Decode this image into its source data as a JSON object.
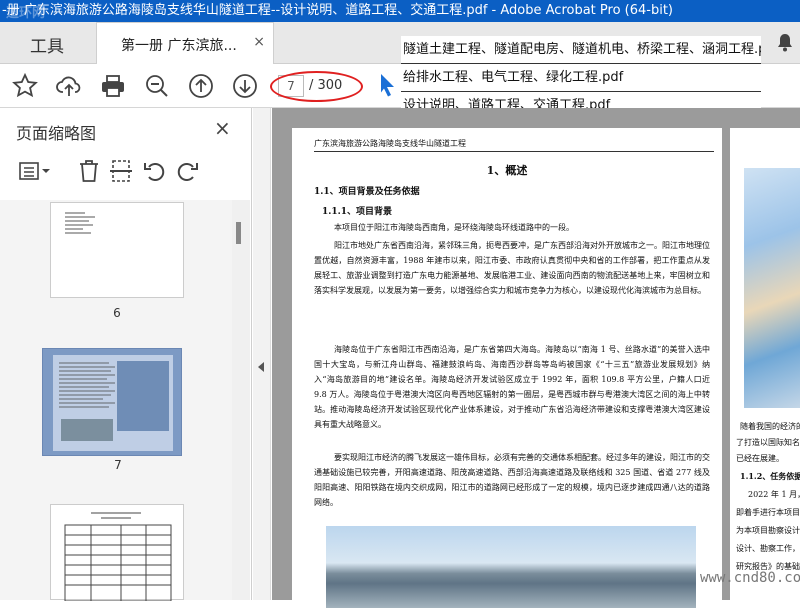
{
  "window": {
    "title": "-册 广东滨海旅游公路海陵岛支线华山隧道工程--设计说明、道路工程、交通工程.pdf - Adobe Acrobat Pro (64-bit)"
  },
  "tabs": {
    "tools_label": "工具",
    "doc_label": "第一册 广东滨旅...",
    "close": "×"
  },
  "toolbar": {
    "current_page": "7",
    "total_pages": "/ 300"
  },
  "file_list": [
    "隧道土建工程、隧道配电房、隧道机电、桥梁工程、涵洞工程.pdf",
    "给排水工程、电气工程、绿化工程.pdf",
    "设计说明、道路工程、交通工程.pdf"
  ],
  "thumbnails_panel": {
    "title": "页面缩略图",
    "close": "×",
    "pages": [
      {
        "label": "6"
      },
      {
        "label": "7"
      },
      {
        "label": ""
      }
    ]
  },
  "document": {
    "running_head": "广东滨海旅游公路海陵岛支线华山隧道工程",
    "section_title": "1、概述",
    "h1": "1.1、项目背景及任务依据",
    "h2": "1.1.1、项目背景",
    "paragraphs": [
      "本项目位于阳江市海陵岛西南角，是环绕海陵岛环线道路中的一段。",
      "阳江市地处广东省西南沿海，紧邻珠三角，扼粤西要冲，是广东西部沿海对外开放城市之一。阳江市地理位置优越，自然资源丰富，1988 年建市以来，阳江市委、市政府认真贯彻中央和省的工作部署，把工作重点从发展轻工、旅游业调整到打造广东电力能源基地、发展临港工业、建设面向西南的物流配送基地上来，牢固树立和落实科学发展观，以发展为第一要务，以增强综合实力和城市竞争力为核心，以建设现代化海滨城市为总目标。",
      "海陵岛位于广东省阳江市西南沿海，是广东省第四大海岛。海陵岛以“南海 1 号、丝路水道”的美誉入选中国十大宝岛，与新江舟山群岛、福建鼓浪屿岛、海南西沙群岛等岛屿被国家《“十三五”旅游业发展规划》纳入“海岛旅游目的地”建设名单。海陵岛经济开发试验区成立于 1992 年，面积 109.8 平方公里，户籍人口近 9.8 万人。海陵岛位于粤港澳大湾区向粤西地区辐射的第一圈层，是粤西城市群与粤港澳大湾区之间的海上中转站。推动海陵岛经济开发试验区现代化产业体系建设，对于推动广东省沿海经济带建设和支撑粤港澳大湾区建设具有重大战略意义。",
      "要实现阳江市经济的腾飞发展这一雄伟目标，必须有完善的交通体系相配套。经过多年的建设，阳江市的交通基础设施已较完善，开阳高速道路、阳茂高速道路、西部沿海高速道路及联络线和 325 国道、省道 277 线及阳阳高速、阳阳铁路在境内交织成网，阳江市的道路网已经形成了一定的规模，境内已逐步建成四通八达的道路网络。"
    ],
    "right_lines": [
      "随着我国的经济的",
      "了打造以国际知名的旅",
      "已经在展建。",
      "1.1.2、任务依据",
      "2022 年 1 月，阳",
      "即着手进行本项目技术",
      "为本项目勘察设计的中",
      "设计、勘察工作，本次",
      "研究报告》的基础上，"
    ]
  },
  "watermarks": {
    "top_left": "道环网",
    "bottom_right": "www.cnd80.com"
  }
}
